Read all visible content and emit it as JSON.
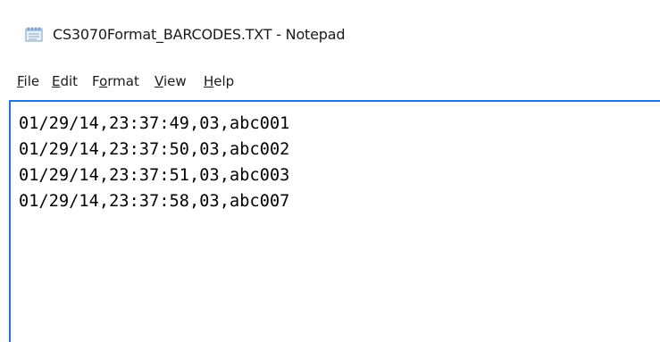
{
  "window": {
    "title": "CS3070Format_BARCODES.TXT - Notepad",
    "icon": "notepad-icon"
  },
  "menu": {
    "items": [
      {
        "pre": "",
        "acc": "F",
        "post": "ile"
      },
      {
        "pre": "",
        "acc": "E",
        "post": "dit"
      },
      {
        "pre": "F",
        "acc": "o",
        "post": "rmat"
      },
      {
        "pre": "",
        "acc": "V",
        "post": "iew"
      },
      {
        "pre": "",
        "acc": "H",
        "post": "elp"
      }
    ]
  },
  "editor": {
    "lines": [
      "01/29/14,23:37:49,03,abc001",
      "01/29/14,23:37:50,03,abc002",
      "01/29/14,23:37:51,03,abc003",
      "01/29/14,23:37:58,03,abc007"
    ]
  },
  "colors": {
    "focus_border": "#1e78d7",
    "background": "#ffffff",
    "text": "#000000"
  }
}
